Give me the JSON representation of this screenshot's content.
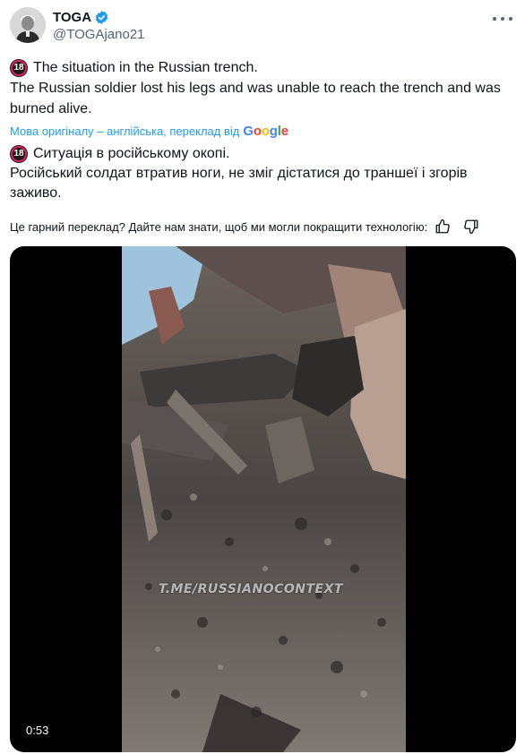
{
  "author": {
    "display_name": "TOGA",
    "handle": "@TOGAjano21",
    "verified": true,
    "avatar_icon": "portrait-avatar"
  },
  "tweet": {
    "age_badge": "18",
    "line1": "The situation in the Russian trench.",
    "line2": "The Russian soldier lost his legs and was unable to reach the trench and was burned alive."
  },
  "translation": {
    "label": "Мова оригіналу – англійська, переклад від",
    "provider": "Google",
    "age_badge": "18",
    "line1": "Ситуація в російському окопі.",
    "line2": "Російський солдат втратив ноги, не зміг дістатися до траншеї і згорів заживо."
  },
  "feedback": {
    "question": "Це гарний переклад? Дайте нам знати, щоб ми могли покращити технологію:",
    "up_icon": "thumbs-up-icon",
    "down_icon": "thumbs-down-icon"
  },
  "media": {
    "watermark": "T.ME/RUSSIANOCONTEXT",
    "duration": "0:53"
  },
  "colors": {
    "link": "#1d9bf0",
    "text": "#0f1419",
    "secondary": "#536471",
    "verified": "#1d9bf0"
  }
}
